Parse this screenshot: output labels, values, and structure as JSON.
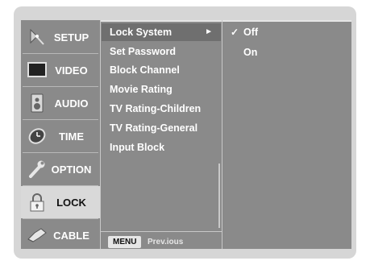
{
  "categories": [
    {
      "label": "SETUP",
      "icon": "antenna-icon"
    },
    {
      "label": "VIDEO",
      "icon": "monitor-icon"
    },
    {
      "label": "AUDIO",
      "icon": "speaker-icon"
    },
    {
      "label": "TIME",
      "icon": "clock-icon"
    },
    {
      "label": "OPTION",
      "icon": "wrench-icon"
    },
    {
      "label": "LOCK",
      "icon": "padlock-icon"
    },
    {
      "label": "CABLE",
      "icon": "cable-icon"
    }
  ],
  "active_category": "LOCK",
  "submenu": {
    "items": [
      "Lock System",
      "Set Password",
      "Block Channel",
      "Movie Rating",
      "TV Rating-Children",
      "TV Rating-General",
      "Input Block"
    ],
    "selected": "Lock System",
    "arrow": "►"
  },
  "options": {
    "items": [
      "Off",
      "On"
    ],
    "checked": "Off",
    "check_mark": "✓"
  },
  "footer": {
    "button": "MENU",
    "help": "Prev.ious"
  },
  "colors": {
    "panel": "#8a8a8a",
    "frame": "#d6d6d6",
    "active_category": "#d9d9d9"
  }
}
